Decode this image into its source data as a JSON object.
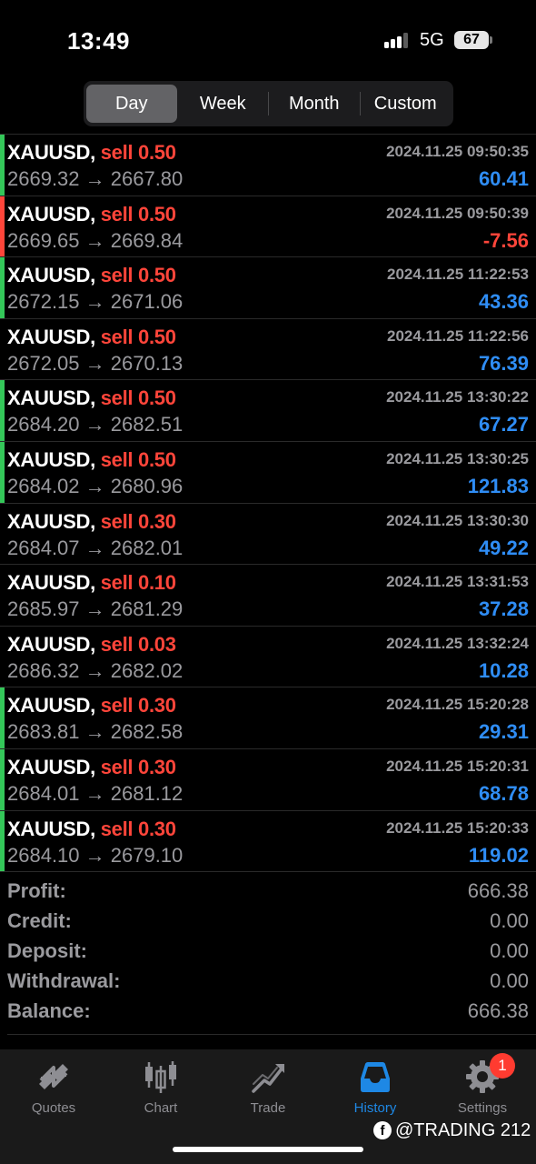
{
  "status": {
    "time": "13:49",
    "network": "5G",
    "battery": "67"
  },
  "period_tabs": [
    {
      "label": "Day",
      "active": true
    },
    {
      "label": "Week",
      "active": false
    },
    {
      "label": "Month",
      "active": false
    },
    {
      "label": "Custom",
      "active": false
    }
  ],
  "trades": [
    {
      "symbol": "XAUUSD,",
      "side": "sell 0.50",
      "time": "2024.11.25 09:50:35",
      "prices": "2669.32 → 2667.80",
      "profit": "60.41",
      "profit_color": "#2f8df5",
      "bar_color": "#34c759"
    },
    {
      "symbol": "XAUUSD,",
      "side": "sell 0.50",
      "time": "2024.11.25 09:50:39",
      "prices": "2669.65 → 2669.84",
      "profit": "-7.56",
      "profit_color": "#ff453a",
      "bar_color": "#ff453a"
    },
    {
      "symbol": "XAUUSD,",
      "side": "sell 0.50",
      "time": "2024.11.25 11:22:53",
      "prices": "2672.15 → 2671.06",
      "profit": "43.36",
      "profit_color": "#2f8df5",
      "bar_color": "#34c759"
    },
    {
      "symbol": "XAUUSD,",
      "side": "sell 0.50",
      "time": "2024.11.25 11:22:56",
      "prices": "2672.05 → 2670.13",
      "profit": "76.39",
      "profit_color": "#2f8df5",
      "bar_color": "transparent"
    },
    {
      "symbol": "XAUUSD,",
      "side": "sell 0.50",
      "time": "2024.11.25 13:30:22",
      "prices": "2684.20 → 2682.51",
      "profit": "67.27",
      "profit_color": "#2f8df5",
      "bar_color": "#34c759"
    },
    {
      "symbol": "XAUUSD,",
      "side": "sell 0.50",
      "time": "2024.11.25 13:30:25",
      "prices": "2684.02 → 2680.96",
      "profit": "121.83",
      "profit_color": "#2f8df5",
      "bar_color": "#34c759"
    },
    {
      "symbol": "XAUUSD,",
      "side": "sell 0.30",
      "time": "2024.11.25 13:30:30",
      "prices": "2684.07 → 2682.01",
      "profit": "49.22",
      "profit_color": "#2f8df5",
      "bar_color": "transparent"
    },
    {
      "symbol": "XAUUSD,",
      "side": "sell 0.10",
      "time": "2024.11.25 13:31:53",
      "prices": "2685.97 → 2681.29",
      "profit": "37.28",
      "profit_color": "#2f8df5",
      "bar_color": "transparent"
    },
    {
      "symbol": "XAUUSD,",
      "side": "sell 0.03",
      "time": "2024.11.25 13:32:24",
      "prices": "2686.32 → 2682.02",
      "profit": "10.28",
      "profit_color": "#2f8df5",
      "bar_color": "transparent"
    },
    {
      "symbol": "XAUUSD,",
      "side": "sell 0.30",
      "time": "2024.11.25 15:20:28",
      "prices": "2683.81 → 2682.58",
      "profit": "29.31",
      "profit_color": "#2f8df5",
      "bar_color": "#34c759"
    },
    {
      "symbol": "XAUUSD,",
      "side": "sell 0.30",
      "time": "2024.11.25 15:20:31",
      "prices": "2684.01 → 2681.12",
      "profit": "68.78",
      "profit_color": "#2f8df5",
      "bar_color": "#34c759"
    },
    {
      "symbol": "XAUUSD,",
      "side": "sell 0.30",
      "time": "2024.11.25 15:20:33",
      "prices": "2684.10 → 2679.10",
      "profit": "119.02",
      "profit_color": "#2f8df5",
      "bar_color": "#34c759"
    }
  ],
  "summary": [
    {
      "label": "Profit:",
      "value": "666.38"
    },
    {
      "label": "Credit:",
      "value": "0.00"
    },
    {
      "label": "Deposit:",
      "value": "0.00"
    },
    {
      "label": "Withdrawal:",
      "value": "0.00"
    },
    {
      "label": "Balance:",
      "value": "666.38"
    }
  ],
  "tabbar": [
    {
      "label": "Quotes",
      "icon": "quotes-icon",
      "active": false
    },
    {
      "label": "Chart",
      "icon": "chart-icon",
      "active": false
    },
    {
      "label": "Trade",
      "icon": "trade-icon",
      "active": false
    },
    {
      "label": "History",
      "icon": "history-icon",
      "active": true
    },
    {
      "label": "Settings",
      "icon": "settings-icon",
      "active": false,
      "badge": "1"
    }
  ],
  "watermark": {
    "icon": "f",
    "text": "@TRADING 212"
  },
  "colors": {
    "accent": "#1e88e5",
    "sell": "#ff453a",
    "profit": "#2f8df5",
    "muted": "#9a9a9e",
    "win_bar": "#34c759",
    "loss_bar": "#ff453a"
  }
}
